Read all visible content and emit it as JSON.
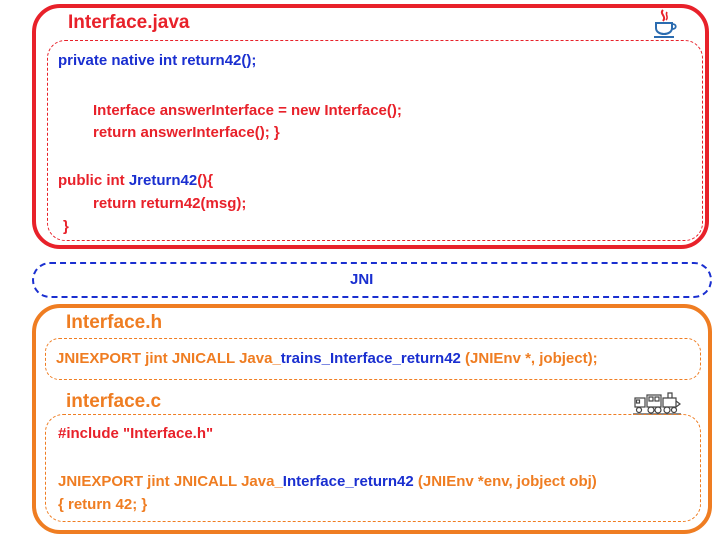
{
  "java_panel": {
    "title": "Interface.java",
    "lines": {
      "native_decl": "private native int return42();",
      "answer_decl": "Interface answerInterface = new Interface();",
      "return_answer": "return answerInterface(); }",
      "public_prefix": "public int ",
      "public_method": "Jreturn42",
      "public_suffix": "(){",
      "return_call": "return return42(msg);",
      "close_brace": "}"
    }
  },
  "jni_bridge": {
    "label": "JNI"
  },
  "header_panel": {
    "title": "Interface.h",
    "line_prefix": "JNIEXPORT jint JNICALL Java_",
    "line_method": "trains_Interface_return42",
    "line_suffix": " (JNIEnv *, jobject);"
  },
  "c_panel": {
    "title": "interface.c",
    "include_line": "#include \"Interface.h\"",
    "func_prefix": "JNIEXPORT jint JNICALL Java_",
    "func_method": "Interface_return42",
    "func_suffix": " (JNIEnv *env, jobject obj)",
    "body_line": "{ return 42; }"
  },
  "icons": {
    "java": "java-cup-icon",
    "train": "train-icon"
  },
  "colors": {
    "java": "#e8212a",
    "jni": "#1a2fd0",
    "native": "#ef7d22",
    "method": "#1a2fd0"
  }
}
